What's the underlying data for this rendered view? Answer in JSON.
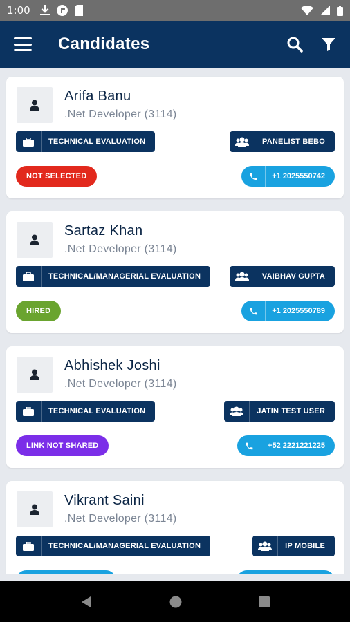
{
  "status_bar": {
    "time": "1:00"
  },
  "app_bar": {
    "title": "Candidates"
  },
  "colors": {
    "primary": "#0b3360",
    "phone": "#19a2e0",
    "not_selected": "#e2291d",
    "hired": "#6aa42f",
    "link_not_shared": "#7b2ee8"
  },
  "candidates": [
    {
      "name": "Arifa Banu",
      "role": ".Net Developer (3114)",
      "stage": "TECHNICAL EVALUATION",
      "panelist": "PANELIST BEBO",
      "status": "NOT SELECTED",
      "phone": "+1 2025550742"
    },
    {
      "name": "Sartaz Khan",
      "role": ".Net Developer (3114)",
      "stage": "TECHNICAL/MANAGERIAL EVALUATION",
      "panelist": "VAIBHAV GUPTA",
      "status": "HIRED",
      "phone": "+1 2025550789"
    },
    {
      "name": "Abhishek Joshi",
      "role": ".Net Developer (3114)",
      "stage": "TECHNICAL EVALUATION",
      "panelist": "JATIN TEST USER",
      "status": "LINK NOT SHARED",
      "phone": "+52 2221221225"
    },
    {
      "name": "Vikrant Saini",
      "role": ".Net Developer (3114)",
      "stage": "TECHNICAL/MANAGERIAL EVALUATION",
      "panelist": "IP MOBILE"
    }
  ]
}
